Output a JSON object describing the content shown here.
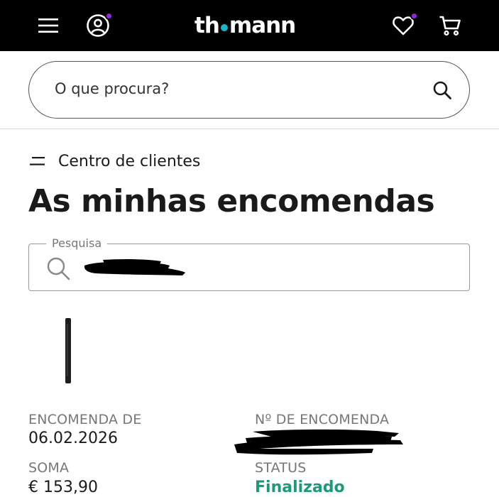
{
  "header": {
    "logo_left": "th",
    "logo_right": "mann",
    "icons": [
      "menu-icon",
      "account-icon",
      "wishlist-heart-icon",
      "cart-icon"
    ],
    "colors": {
      "bar": "#000000",
      "notification_dot": "#8b2bd9",
      "logo_dot": "#18b4c8"
    }
  },
  "search": {
    "placeholder": "O que procura?"
  },
  "breadcrumb": {
    "label": "Centro de clientes"
  },
  "page": {
    "title": "As minhas encomendas"
  },
  "filter": {
    "legend": "Pesquisa"
  },
  "order": {
    "date_label": "ENCOMENDA DE",
    "date_value": "06.02.2026",
    "number_label": "Nº DE ENCOMENDA",
    "sum_label": "SOMA",
    "sum_value": "€ 153,90",
    "status_label": "STATUS",
    "status_value": "Finalizado",
    "status_color": "#1c9a78"
  }
}
